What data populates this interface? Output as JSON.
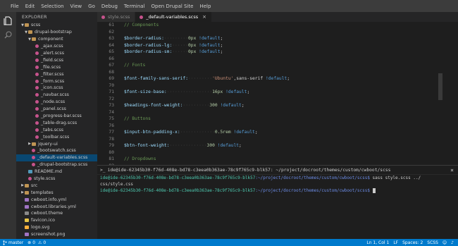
{
  "menu": [
    "File",
    "Edit",
    "Selection",
    "View",
    "Go",
    "Debug",
    "Terminal",
    "Open Drupal Site",
    "Help"
  ],
  "sidebar": {
    "title": "EXPLORER",
    "tree": [
      {
        "label": "scss",
        "type": "folder",
        "depth": 2,
        "arrow": "▼"
      },
      {
        "label": "drupal-bootstrap",
        "type": "folder",
        "depth": 3,
        "arrow": "▼"
      },
      {
        "label": "component",
        "type": "folder",
        "depth": 4,
        "arrow": "▼"
      },
      {
        "label": "_ajax.scss",
        "type": "scss",
        "depth": 5
      },
      {
        "label": "_alert.scss",
        "type": "scss",
        "depth": 5
      },
      {
        "label": "_field.scss",
        "type": "scss",
        "depth": 5
      },
      {
        "label": "_file.scss",
        "type": "scss",
        "depth": 5
      },
      {
        "label": "_filter.scss",
        "type": "scss",
        "depth": 5
      },
      {
        "label": "_form.scss",
        "type": "scss",
        "depth": 5
      },
      {
        "label": "_icon.scss",
        "type": "scss",
        "depth": 5
      },
      {
        "label": "_navbar.scss",
        "type": "scss",
        "depth": 5
      },
      {
        "label": "_node.scss",
        "type": "scss",
        "depth": 5
      },
      {
        "label": "_panel.scss",
        "type": "scss",
        "depth": 5
      },
      {
        "label": "_progress-bar.scss",
        "type": "scss",
        "depth": 5
      },
      {
        "label": "_table-drag.scss",
        "type": "scss",
        "depth": 5
      },
      {
        "label": "_tabs.scss",
        "type": "scss",
        "depth": 5
      },
      {
        "label": "_toolbar.scss",
        "type": "scss",
        "depth": 5
      },
      {
        "label": "jquery-ui",
        "type": "folder",
        "depth": 4,
        "arrow": "▶"
      },
      {
        "label": "_bootswatch.scss",
        "type": "scss",
        "depth": 4
      },
      {
        "label": "_default-variables.scss",
        "type": "scss",
        "depth": 4,
        "selected": true
      },
      {
        "label": "_drupal-bootstrap.scss",
        "type": "scss",
        "depth": 4
      },
      {
        "label": "README.md",
        "type": "md",
        "depth": 3
      },
      {
        "label": "style.scss",
        "type": "scss",
        "depth": 3
      },
      {
        "label": "src",
        "type": "folder",
        "depth": 2,
        "arrow": "▶"
      },
      {
        "label": "templates",
        "type": "folder",
        "depth": 2,
        "arrow": "▶"
      },
      {
        "label": "cwboot.info.yml",
        "type": "yml",
        "depth": 2
      },
      {
        "label": "cwboot.libraries.yml",
        "type": "yml",
        "depth": 2
      },
      {
        "label": "cwboot.theme",
        "type": "theme",
        "depth": 2
      },
      {
        "label": "favicon.ico",
        "type": "ico",
        "depth": 2
      },
      {
        "label": "logo.svg",
        "type": "svg",
        "depth": 2
      },
      {
        "label": "screenshot.png",
        "type": "png",
        "depth": 2
      }
    ]
  },
  "tabs": [
    {
      "label": "style.scss",
      "active": false
    },
    {
      "label": "_default-variables.scss",
      "active": true,
      "close": "×"
    }
  ],
  "editor": {
    "lines": [
      {
        "n": "61",
        "parts": [
          [
            "comment",
            "// Components"
          ]
        ]
      },
      {
        "n": "62",
        "parts": []
      },
      {
        "n": "63",
        "parts": [
          [
            "var",
            "$border-radius:"
          ],
          [
            "dots",
            "·········"
          ],
          [
            "num",
            "0px"
          ],
          [
            "plain",
            " "
          ],
          [
            "kw",
            "!default"
          ],
          [
            "plain",
            ";"
          ]
        ]
      },
      {
        "n": "64",
        "parts": [
          [
            "var",
            "$border-radius-lg:"
          ],
          [
            "dots",
            "······"
          ],
          [
            "num",
            "0px"
          ],
          [
            "plain",
            " "
          ],
          [
            "kw",
            "!default"
          ],
          [
            "plain",
            ";"
          ]
        ]
      },
      {
        "n": "65",
        "parts": [
          [
            "var",
            "$border-radius-sm:"
          ],
          [
            "dots",
            "······"
          ],
          [
            "num",
            "0px"
          ],
          [
            "plain",
            " "
          ],
          [
            "kw",
            "!default"
          ],
          [
            "plain",
            ";"
          ]
        ]
      },
      {
        "n": "66",
        "parts": []
      },
      {
        "n": "67",
        "parts": [
          [
            "comment",
            "// Fonts"
          ]
        ]
      },
      {
        "n": "68",
        "parts": []
      },
      {
        "n": "69",
        "parts": [
          [
            "var",
            "$font-family-sans-serif:"
          ],
          [
            "dots",
            "·········"
          ],
          [
            "str",
            "'Ubuntu'"
          ],
          [
            "plain",
            ",sans-serif "
          ],
          [
            "kw",
            "!default"
          ],
          [
            "plain",
            ";"
          ]
        ]
      },
      {
        "n": "70",
        "parts": []
      },
      {
        "n": "71",
        "parts": [
          [
            "var",
            "$font-size-base:"
          ],
          [
            "dots",
            "·················"
          ],
          [
            "num",
            "16px"
          ],
          [
            "plain",
            " "
          ],
          [
            "kw",
            "!default"
          ],
          [
            "plain",
            ";"
          ]
        ]
      },
      {
        "n": "72",
        "parts": []
      },
      {
        "n": "73",
        "parts": [
          [
            "var",
            "$headings-font-weight:"
          ],
          [
            "dots",
            "··········"
          ],
          [
            "num",
            "300"
          ],
          [
            "plain",
            " "
          ],
          [
            "kw",
            "!default"
          ],
          [
            "plain",
            ";"
          ]
        ]
      },
      {
        "n": "74",
        "parts": []
      },
      {
        "n": "75",
        "parts": [
          [
            "comment",
            "// Buttons"
          ]
        ]
      },
      {
        "n": "76",
        "parts": []
      },
      {
        "n": "77",
        "parts": [
          [
            "var",
            "$input-btn-padding-x:"
          ],
          [
            "dots",
            "·············"
          ],
          [
            "num",
            "0.5rem"
          ],
          [
            "plain",
            " "
          ],
          [
            "kw",
            "!default"
          ],
          [
            "plain",
            ";"
          ]
        ]
      },
      {
        "n": "78",
        "parts": []
      },
      {
        "n": "79",
        "parts": [
          [
            "var",
            "$btn-font-weight:"
          ],
          [
            "dots",
            "··············"
          ],
          [
            "num",
            "300"
          ],
          [
            "plain",
            " "
          ],
          [
            "kw",
            "!default"
          ],
          [
            "plain",
            ";"
          ]
        ]
      },
      {
        "n": "80",
        "parts": []
      },
      {
        "n": "81",
        "parts": [
          [
            "comment",
            "// Dropdowns"
          ]
        ]
      },
      {
        "n": "82",
        "parts": []
      },
      {
        "n": "83",
        "parts": [
          [
            "var",
            "$dropdown-border-color:"
          ],
          [
            "dots",
            "·············"
          ],
          [
            "fn",
            "rgba"
          ],
          [
            "plain",
            "("
          ],
          [
            "var",
            "$black"
          ],
          [
            "plain",
            ",.1) "
          ],
          [
            "kw",
            "!default"
          ],
          [
            "plain",
            ";"
          ]
        ]
      },
      {
        "n": "84",
        "parts": [
          [
            "var",
            "$dropdown-divider-bg:"
          ],
          [
            "dots",
            "···············"
          ],
          [
            "fn",
            "rgba"
          ],
          [
            "plain",
            "("
          ],
          [
            "var",
            "$black"
          ],
          [
            "plain",
            ",.1) "
          ],
          [
            "kw",
            "!default"
          ],
          [
            "plain",
            ";"
          ]
        ]
      },
      {
        "n": "85",
        "parts": []
      }
    ]
  },
  "terminal": {
    "title": "ide@ide-62345b30-f76d-408e-bd78-c3eea0b363ae-78c9f765c9-blk57: ~/project/docroot/themes/custom/cwboot/scss",
    "close": "×",
    "lines": [
      {
        "prompt": "ide@ide-62345b30-f76d-408e-bd78-c3eea0b363ae-78c9f765c9-blk57",
        "path": ":~/project/docroot/themes/custom/cwboot/scss$",
        "cmd": " sass style.scss ../"
      },
      {
        "prompt": "",
        "path": "",
        "cmd": "css/style.css"
      },
      {
        "prompt": "ide@ide-62345b30-f76d-408e-bd78-c3eea0b363ae-78c9f765c9-blk57",
        "path": ":~/project/docroot/themes/custom/cwboot/scss$",
        "cmd": " ",
        "cursor": true
      }
    ]
  },
  "statusbar": {
    "branch": "master",
    "errors": "0",
    "warnings": "0",
    "cursor": "Ln 1, Col 1",
    "eol": "LF",
    "indent": "Spaces: 2",
    "language": "SCSS"
  },
  "colors": {
    "statusbar": "#007acc",
    "selection": "#094771",
    "menubar": "#3c3c3c"
  }
}
